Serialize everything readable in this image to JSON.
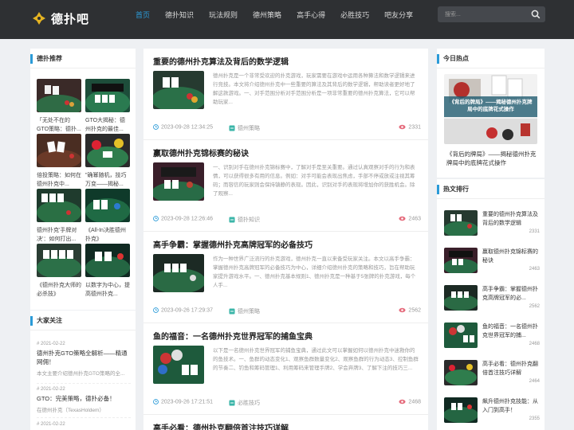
{
  "header": {
    "logo_text": "德扑吧",
    "nav": [
      "首页",
      "德扑知识",
      "玩法规则",
      "德州策略",
      "高手心得",
      "必胜技巧",
      "吧友分享"
    ],
    "active_nav_index": 0,
    "search_placeholder": "搜索...",
    "colors": {
      "bar": "#2e3033",
      "accent": "#2b9bd8"
    }
  },
  "recommend": {
    "title": "德扑推荐",
    "items": [
      {
        "title": "「无处不在的GTO策略：德扑..."
      },
      {
        "title": "GTO大揭秘：德州扑克的最佳..."
      },
      {
        "title": "倍投策略：如何在德州扑克中..."
      },
      {
        "title": "\"确幂随机，技巧万变——揭秘..."
      },
      {
        "title": "德州扑克'手牌对决'：如何打出..."
      },
      {
        "title": "《All-In决胜德州扑克》"
      },
      {
        "title": "《德州扑克大师的必杀技》"
      },
      {
        "title": "以数字为中心，提高德州扑克..."
      }
    ]
  },
  "focus": {
    "title": "大家关注",
    "items": [
      {
        "date": "2021-02-22",
        "title": "德州扑克GTO策略全解析——精通网佣！",
        "sub": "本文主要介绍德州扑克GTO策略的全..."
      },
      {
        "date": "2021-02-22",
        "title": "GTO：完美策略，德扑必备！",
        "sub": "在德州扑克（TexasHoldem）"
      },
      {
        "date": "2021-02-22",
        "title": "",
        "sub": ""
      }
    ]
  },
  "articles": [
    {
      "title": "重要的德州扑克算法及背后的数学逻辑",
      "excerpt": "德州扑克是一个非常受欢迎的扑克游戏，玩家需要在游戏中运用各种算法和数学逻辑来进行竞技。本文将介绍德州扑克中一些重要的算法及其背后的数学逻辑，帮助读者更好地了解这款游戏。一、对手范围分析对手范围分析是一项非常重要的德州扑克算法，它可以帮助玩家...",
      "date": "2023-09-28 12:34:25",
      "category": "德州策略",
      "views": "2331"
    },
    {
      "title": "赢取德州扑克锦标赛的秘诀",
      "excerpt": "一、识别对手在德州扑克锦标赛中，了解对手是至关重要。通过认真观察对手的行为和表情，可以获得很多有用的信息。例如：对手可能会表现出焦虑，手部不停或放或注视其筹码；而容信的玩家则会保持镇静的表现。因此，识别对手的表现将增加你的获胜机会。除了观察...",
      "date": "2023-09-28 12:26:46",
      "category": "德扑知识",
      "views": "2463"
    },
    {
      "title": "高手争霸：掌握德州扑克高牌冠军的必备技巧",
      "excerpt": "作为一种世界广泛流行的扑克游戏，德州扑克一直以来备受玩家关注。本文以高手争霸：掌握德州扑克高牌冠军的必备技巧为中心，详细介绍德州扑克的策略和技巧，旨在帮助玩家提升游戏水平。一、德州扑克基本规则1、德州扑克是一种基于5张牌的扑克游戏，每个人手...",
      "date": "2023-09-26 17:29:37",
      "category": "德州策略",
      "views": "2562"
    },
    {
      "title": "鱼的福音：一名德州扑克世界冠军的捕鱼宝典",
      "excerpt": "以下是一名德州扑克世界冠军的捕鱼宝典，通过此文可以掌握如何以德州扑克中迷救你的的鱼技术。一、鱼群的动态变化1、观察鱼群数量变化2、观察鱼群的行为动态3、控制鱼群的节奏二、钓鱼和筹码管理1、利用筹码来管理手牌2、学会弃牌3、了解下注的技巧三...",
      "date": "2023-09-26 17:21:51",
      "category": "必胜技巧",
      "views": "2468"
    },
    {
      "title": "高手必看：德州扑克翻倍首注技巧详解",
      "excerpt": "",
      "date": "",
      "category": "",
      "views": ""
    }
  ],
  "today_hot": {
    "title": "今日热点",
    "banner_text": "《背后的牌局》——揭秘德州扑克牌局中的底牌花式操作",
    "caption": "《背后的牌局》——揭秘德州扑克牌局中的底牌花式操作"
  },
  "hot_rank": {
    "title": "热文排行",
    "items": [
      {
        "title": "重要的德州扑克算法及背后的数学逻辑",
        "views": "2331"
      },
      {
        "title": "赢取德州扑克锦标赛的秘诀",
        "views": "2463"
      },
      {
        "title": "高手争霸：掌握德州扑克高牌冠军的必...",
        "views": "2562"
      },
      {
        "title": "鱼的福音：一名德州扑克世界冠军的捕...",
        "views": "2468"
      },
      {
        "title": "高手必看：德州扑克翻倍首注技巧详解",
        "views": "2464"
      },
      {
        "title": "飙升德州扑克技能：从入门到高手！",
        "views": "2355"
      }
    ]
  }
}
